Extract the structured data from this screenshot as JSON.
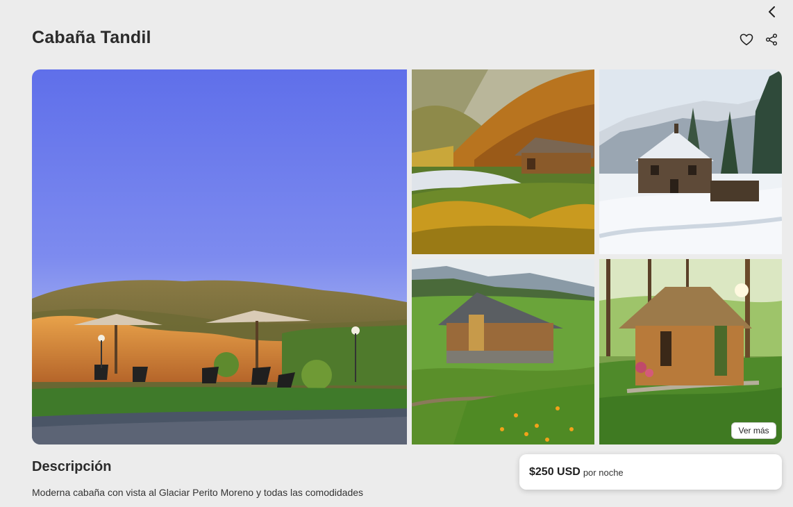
{
  "header": {
    "title": "Cabaña Tandil",
    "back_icon": "chevron-left-icon",
    "favorite_icon": "heart-icon",
    "share_icon": "share-icon"
  },
  "gallery": {
    "main_photo": "garden-with-umbrellas-and-chairs-at-sunset",
    "photos": [
      "log-cabin-in-autumn-mountain-valley",
      "wooden-cabin-in-snowy-mountains",
      "log-cabin-on-green-hillside-with-flowers",
      "thatched-cabin-in-sunlit-forest"
    ],
    "more_label": "Ver más"
  },
  "description": {
    "title": "Descripción",
    "text": "Moderna cabaña con vista al Glaciar Perito Moreno y todas las comodidades"
  },
  "price": {
    "amount": "$250 USD",
    "unit": "por noche"
  }
}
